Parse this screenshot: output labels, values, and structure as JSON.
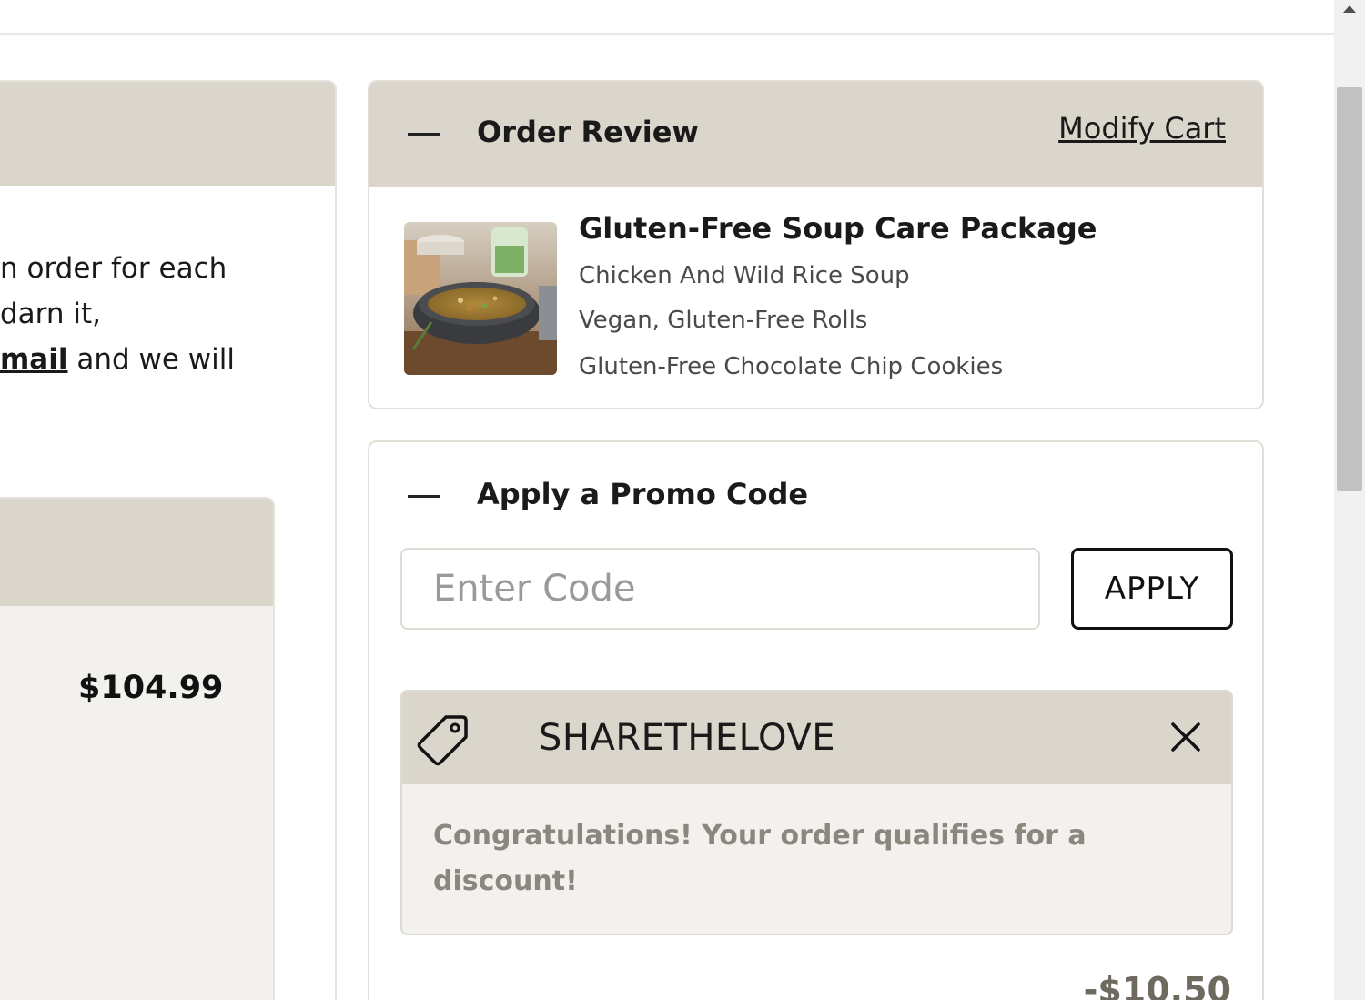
{
  "left": {
    "text_lines": [
      "n order for each",
      "darn it,"
    ],
    "text_line3_link": "mail",
    "text_line3_rest": " and we will",
    "price": "$104.99"
  },
  "order_review": {
    "title": "Order Review",
    "modify_link": "Modify Cart",
    "product": {
      "name": "Gluten-Free Soup Care Package",
      "items": [
        "Chicken And Wild Rice Soup",
        "Vegan, Gluten-Free Rolls",
        "Gluten-Free Chocolate Chip Cookies"
      ]
    }
  },
  "promo": {
    "title": "Apply a Promo Code",
    "input_placeholder": "Enter Code",
    "input_value": "",
    "apply_label": "APPLY",
    "applied_code": "SHARETHELOVE",
    "message": "Congratulations! Your order qualifies for a discount!",
    "discount": "-$10.50"
  },
  "colors": {
    "header_bg": "#dbd6cc",
    "panel_bg": "#f3f1ed",
    "message_text": "#8a877f"
  },
  "icons": {
    "collapse": "minus-icon",
    "tag": "price-tag-icon",
    "remove": "close-icon"
  }
}
